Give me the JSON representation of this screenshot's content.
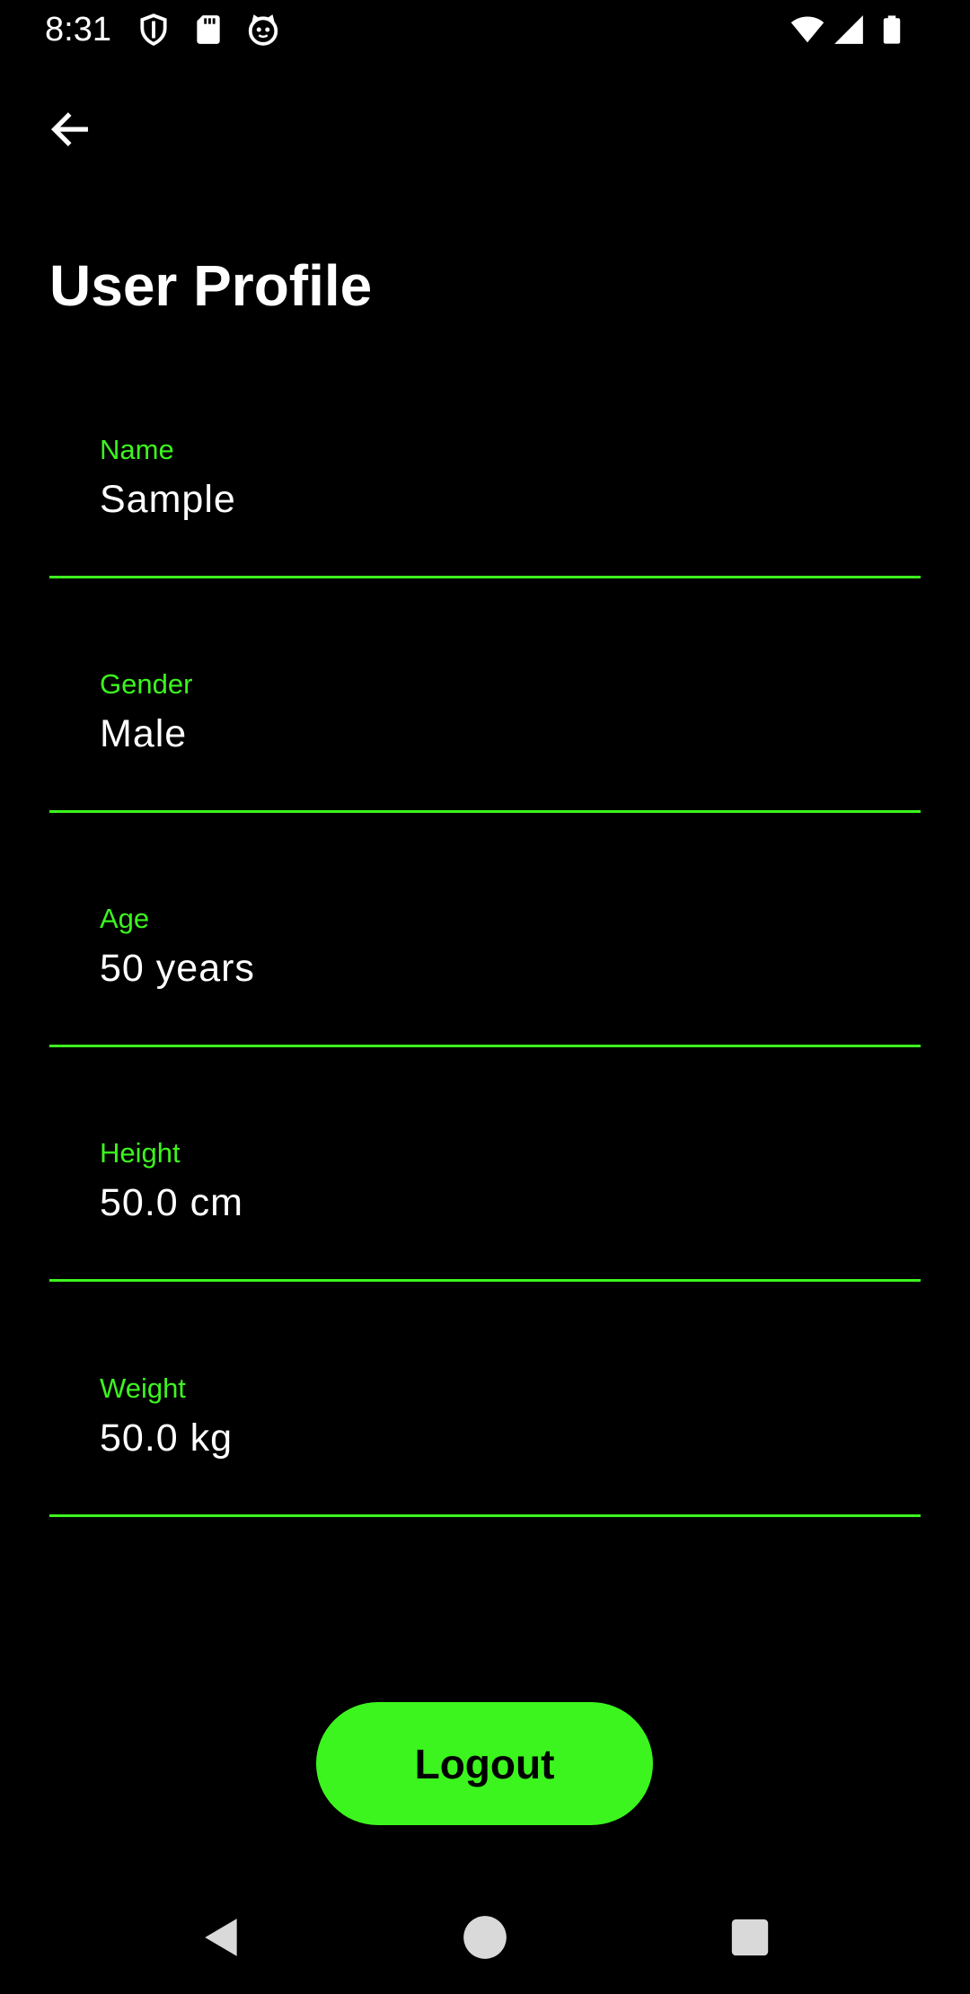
{
  "status_bar": {
    "time": "8:31",
    "icons": [
      "shield-icon",
      "sd-card-icon",
      "cat-face-icon",
      "wifi-icon",
      "cell-signal-icon",
      "battery-icon"
    ]
  },
  "header": {
    "back_icon": "arrow-left-icon",
    "title": "User Profile"
  },
  "profile": {
    "fields": [
      {
        "label": "Name",
        "value": "Sample"
      },
      {
        "label": "Gender",
        "value": "Male"
      },
      {
        "label": "Age",
        "value": "50 years"
      },
      {
        "label": "Height",
        "value": "50.0 cm"
      },
      {
        "label": "Weight",
        "value": "50.0 kg"
      }
    ]
  },
  "actions": {
    "logout_label": "Logout"
  },
  "nav_bar": {
    "buttons": [
      "back-triangle-icon",
      "home-circle-icon",
      "recents-square-icon"
    ]
  },
  "colors": {
    "background": "#000000",
    "accent": "#3cf51e",
    "text": "#ffffff"
  }
}
